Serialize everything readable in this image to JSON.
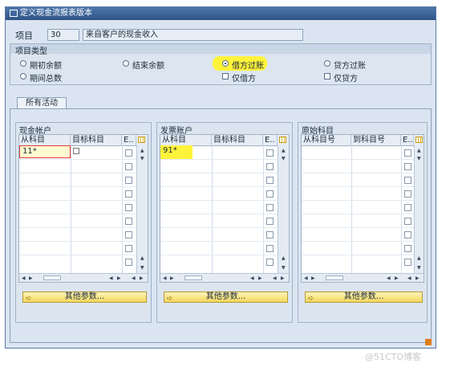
{
  "window": {
    "title": "定义现金流报表版本"
  },
  "item": {
    "label": "项目",
    "number": "30",
    "description": "来自客户的现金收入"
  },
  "item_type": {
    "caption": "项目类型",
    "options": [
      {
        "label": "期初余额",
        "selected": false
      },
      {
        "label": "结束余额",
        "selected": false
      },
      {
        "label": "借方过账",
        "selected": true
      },
      {
        "label": "贷方过账",
        "selected": false
      },
      {
        "label": "期间总数",
        "selected": false
      }
    ],
    "checkboxes": [
      {
        "label": "仅借方",
        "checked": false
      },
      {
        "label": "仅贷方",
        "checked": false
      }
    ]
  },
  "tabs": [
    {
      "label": "所有活动",
      "active": true
    }
  ],
  "panels": {
    "cash": {
      "caption": "现金帐户",
      "col1": "从科目",
      "col2": "目标科目",
      "col3": "E..",
      "first_value": "11*",
      "button": "其他参数..."
    },
    "invoice": {
      "caption": "发票账户",
      "col1": "从科目",
      "col2": "目标科目",
      "col3": "E..",
      "first_value": "91*",
      "button": "其他参数..."
    },
    "orig": {
      "caption": "原始科目",
      "col1": "从科目号",
      "col2": "到科目号",
      "col3": "E..",
      "first_value": "",
      "button": "其他参数..."
    }
  },
  "colors": {
    "titlebar": "#3d6699",
    "highlight": "#fff33a",
    "button": "#f4d65d"
  },
  "watermark": "@51CTO博客"
}
